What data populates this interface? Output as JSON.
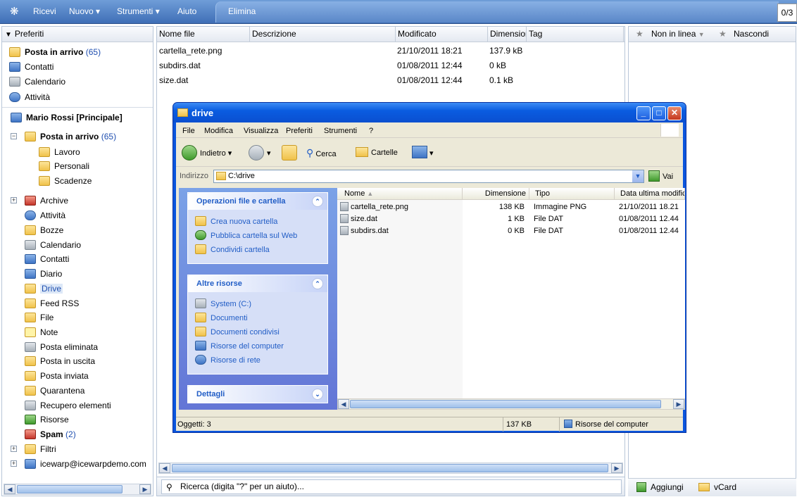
{
  "toolbar": {
    "receive": "Ricevi",
    "new": "Nuovo",
    "tools": "Strumenti",
    "help": "Aiuto",
    "delete": "Elimina",
    "pager": "0/3"
  },
  "left": {
    "header": "Preferiti",
    "favorites": [
      {
        "label": "Posta in arrivo",
        "count": "(65)"
      },
      {
        "label": "Contatti"
      },
      {
        "label": "Calendario"
      },
      {
        "label": "Attività"
      }
    ],
    "account": "Mario Rossi [Principale]",
    "inbox": {
      "label": "Posta in arrivo",
      "count": "(65)"
    },
    "inbox_children": [
      "Lavoro",
      "Personali",
      "Scadenze"
    ],
    "folders": [
      "Archive",
      "Attività",
      "Bozze",
      "Calendario",
      "Contatti",
      "Diario",
      "Drive",
      "Feed RSS",
      "File",
      "Note",
      "Posta eliminata",
      "Posta in uscita",
      "Posta inviata",
      "Quarantena",
      "Recupero elementi",
      "Risorse"
    ],
    "spam": {
      "label": "Spam",
      "count": "(2)"
    },
    "filters": "Filtri",
    "shared": "icewarp@icewarpdemo.com"
  },
  "center": {
    "columns": [
      "Nome file",
      "Descrizione",
      "Modificato",
      "Dimension",
      "Tag"
    ],
    "rows": [
      {
        "name": "cartella_rete.png",
        "modified": "21/10/2011 18:21",
        "size": "137.9 kB"
      },
      {
        "name": "subdirs.dat",
        "modified": "01/08/2011 12:44",
        "size": "0 kB"
      },
      {
        "name": "size.dat",
        "modified": "01/08/2011 12:44",
        "size": "0.1 kB"
      }
    ],
    "search_placeholder": "Ricerca (digita \"?\" per un aiuto)..."
  },
  "right": {
    "offline": "Non in linea",
    "hide": "Nascondi",
    "add": "Aggiungi",
    "vcard": "vCard"
  },
  "explorer": {
    "title": "drive",
    "menu": [
      "File",
      "Modifica",
      "Visualizza",
      "Preferiti",
      "Strumenti",
      "?"
    ],
    "back": "Indietro",
    "search": "Cerca",
    "folders": "Cartelle",
    "address_label": "Indirizzo",
    "address": "C:\\drive",
    "go": "Vai",
    "tasks_title": "Operazioni file e cartella",
    "tasks": [
      "Crea nuova cartella",
      "Pubblica cartella sul Web",
      "Condividi cartella"
    ],
    "other_title": "Altre risorse",
    "other": [
      "System (C:)",
      "Documenti",
      "Documenti condivisi",
      "Risorse del computer",
      "Risorse di rete"
    ],
    "details_title": "Dettagli",
    "list_columns": [
      "Nome",
      "Dimensione",
      "Tipo",
      "Data ultima modifica"
    ],
    "files": [
      {
        "name": "cartella_rete.png",
        "size": "138 KB",
        "type": "Immagine PNG",
        "date": "21/10/2011 18.21"
      },
      {
        "name": "size.dat",
        "size": "1 KB",
        "type": "File DAT",
        "date": "01/08/2011 12.44"
      },
      {
        "name": "subdirs.dat",
        "size": "0 KB",
        "type": "File DAT",
        "date": "01/08/2011 12.44"
      }
    ],
    "status_objects": "Oggetti: 3",
    "status_size": "137 KB",
    "status_location": "Risorse del computer"
  }
}
